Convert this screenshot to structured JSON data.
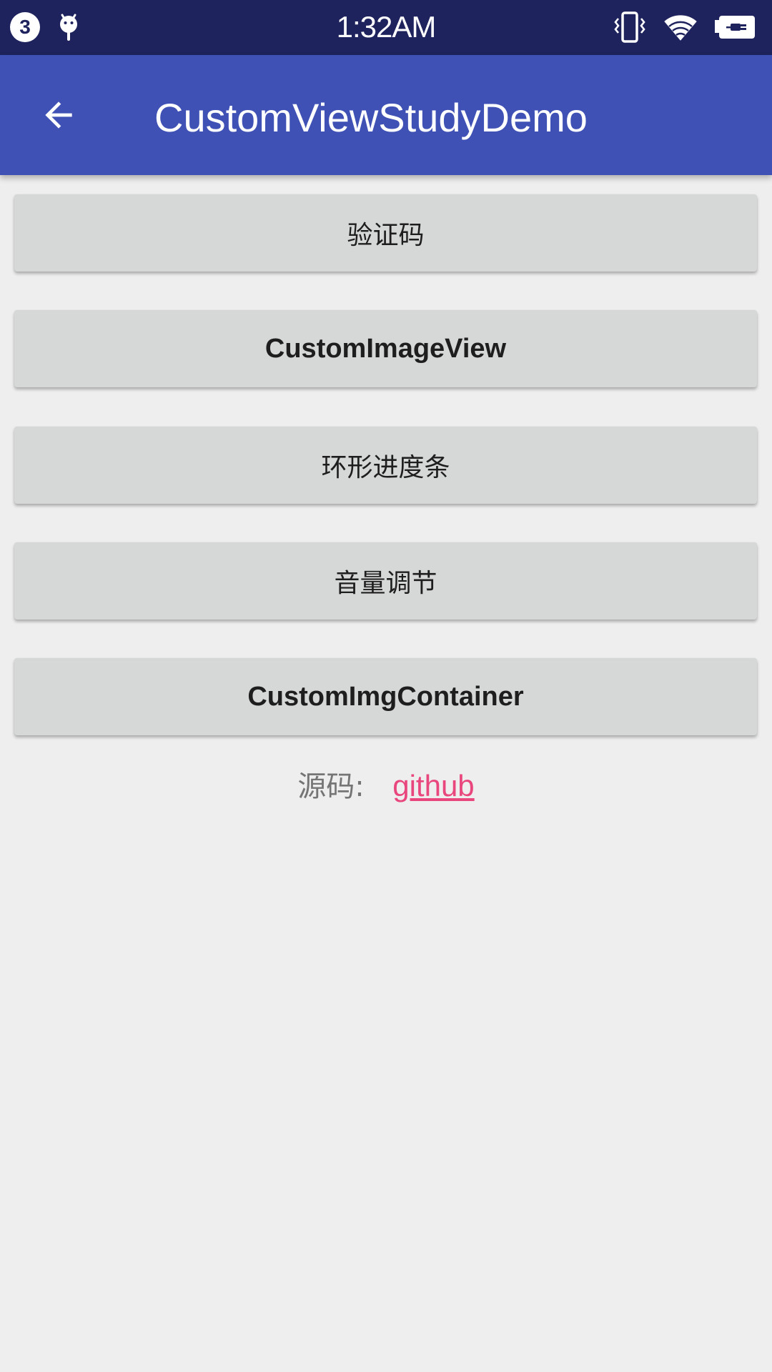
{
  "status_bar": {
    "notification_count": "3",
    "time": "1:32AM",
    "icons": [
      "notification-count-icon",
      "android-debug-icon",
      "vibrate-icon",
      "wifi-icon",
      "battery-charging-icon"
    ]
  },
  "app_bar": {
    "title": "CustomViewStudyDemo",
    "back_icon": "arrow-back-icon"
  },
  "buttons": [
    {
      "label": "验证码"
    },
    {
      "label": "CustomImageView"
    },
    {
      "label": "环形进度条"
    },
    {
      "label": "音量调节"
    },
    {
      "label": "CustomImgContainer"
    }
  ],
  "source": {
    "label": "源码:",
    "link_text": "github"
  },
  "colors": {
    "status_bar": "#1f235d",
    "app_bar": "#3f51b5",
    "background": "#eeeeee",
    "button": "#d6d7d7",
    "link": "#e8467c"
  }
}
